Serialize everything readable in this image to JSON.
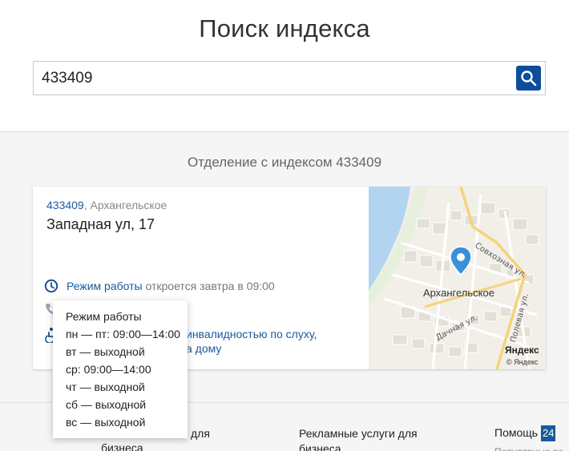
{
  "page": {
    "title": "Поиск индекса"
  },
  "search": {
    "value": "433409",
    "button_label": "search-icon"
  },
  "section": {
    "title": "Отделение с индексом 433409"
  },
  "office": {
    "zip": "433409",
    "city": ", Архангельское",
    "address": "Западная ул, 17",
    "hours_link": "Режим работы",
    "hours_status": "откроется завтра в 09:00",
    "accessibility_line1": "инвалидностью по слуху,",
    "accessibility_line2": "а дому"
  },
  "map": {
    "place_label": "Архангельское",
    "street_1": "Совхозная ул.",
    "street_2": "Полевая ул.",
    "street_3": "Дачная ул.",
    "brand": "Яндекс",
    "copyright": "© Яндекс"
  },
  "popup": {
    "title": "Режим работы",
    "lines": [
      "пн — пт: 09:00—14:00",
      "вт — выходной",
      "ср: 09:00—14:00",
      "чт — выходной",
      "сб — выходной",
      "вс — выходной"
    ]
  },
  "footer": {
    "col1_line1": "для",
    "col1_line2": "бизнеса",
    "col2_line1": "Рекламные услуги для",
    "col2_line2": "бизнеса",
    "col3_label": "Помощь",
    "col3_badge": "24",
    "col3_sub": "Популярные во"
  },
  "colors": {
    "accent": "#0d4d9c",
    "link": "#1a5a9c"
  }
}
